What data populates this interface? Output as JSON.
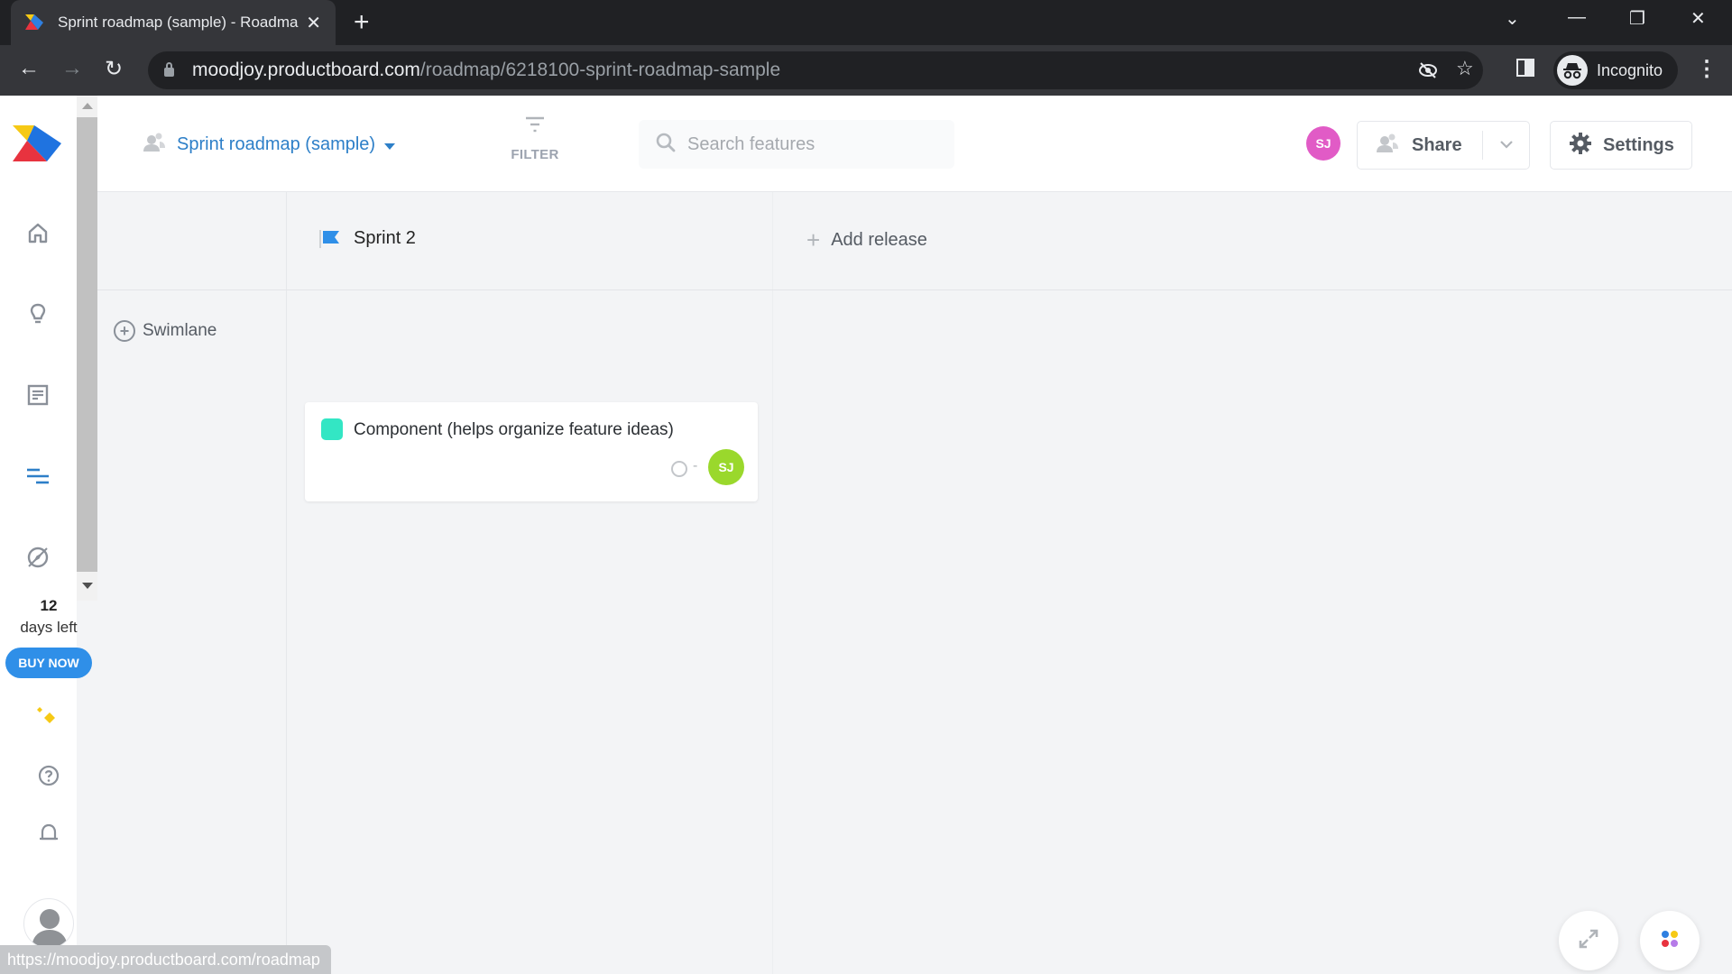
{
  "browser": {
    "tab_title": "Sprint roadmap (sample) - Roadmap",
    "url_host": "moodjoy.productboard.com",
    "url_path": "/roadmap/6218100-sprint-roadmap-sample",
    "profile_label": "Incognito",
    "status_url": "https://moodjoy.productboard.com/roadmap"
  },
  "sidebar": {
    "items": [
      {
        "name": "home",
        "icon": "home-icon"
      },
      {
        "name": "insights",
        "icon": "lightbulb-icon"
      },
      {
        "name": "features",
        "icon": "document-icon"
      },
      {
        "name": "roadmap",
        "icon": "roadmap-icon",
        "active": true
      },
      {
        "name": "portal",
        "icon": "compass-icon"
      }
    ],
    "trial_days": "12",
    "trial_text": "days left",
    "buy_label": "BUY NOW",
    "bottom_icons": [
      "sparkle-icon",
      "help-icon",
      "bell-icon",
      "user-avatar"
    ]
  },
  "header": {
    "roadmap_title": "Sprint roadmap (sample)",
    "filter_label": "FILTER",
    "search_placeholder": "Search features",
    "user_initials": "SJ",
    "share_label": "Share",
    "settings_label": "Settings"
  },
  "board": {
    "releases": [
      {
        "label": "Sprint 2"
      }
    ],
    "add_release_label": "Add release",
    "swimlane_label": "Swimlane",
    "cards": [
      {
        "title": "Component (helps organize feature ideas)",
        "color": "#33e6c4",
        "effort": "-",
        "owner_initials": "SJ"
      }
    ]
  },
  "colors": {
    "accent": "#2d7fc8",
    "buy_button": "#2f8fe8",
    "avatar_pink": "#e15bc6",
    "avatar_green": "#9ad82c"
  }
}
